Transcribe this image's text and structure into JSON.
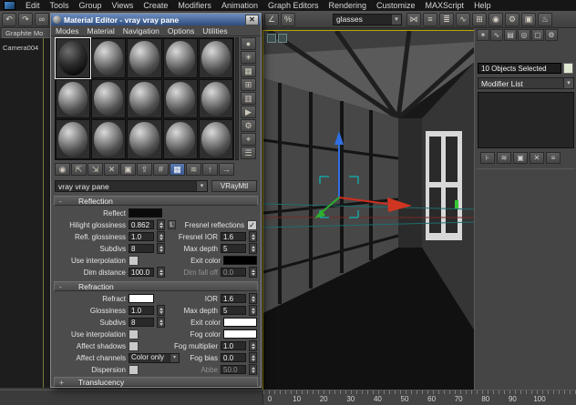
{
  "menubar": {
    "items": [
      "Edit",
      "Tools",
      "Group",
      "Views",
      "Create",
      "Modifiers",
      "Animation",
      "Graph Editors",
      "Rendering",
      "Customize",
      "MAXScript",
      "Help"
    ]
  },
  "icons": {
    "combo_arrow": "▾",
    "close": "✕"
  },
  "main_toolbar": {
    "icons_left": [
      {
        "name": "undo-icon",
        "glyph": "↶"
      },
      {
        "name": "redo-icon",
        "glyph": "↷"
      },
      {
        "name": "select-link-icon",
        "glyph": "∞"
      },
      {
        "name": "unlink-selection-icon",
        "glyph": "⊘"
      },
      {
        "name": "bind-to-space-warp-icon",
        "glyph": "≈"
      },
      {
        "name": "select-object-icon",
        "glyph": "⌖"
      },
      {
        "name": "select-by-name-icon",
        "glyph": "☰"
      },
      {
        "name": "rectangular-selection-region-icon",
        "glyph": "▢"
      },
      {
        "name": "window-crossing-toggle-icon",
        "glyph": "◫"
      },
      {
        "name": "select-and-move-icon",
        "glyph": "✛"
      },
      {
        "name": "select-and-rotate-icon",
        "glyph": "↻"
      },
      {
        "name": "select-and-scale-icon",
        "glyph": "◱"
      },
      {
        "name": "reference-coordinate-system-icon",
        "glyph": "⌂"
      },
      {
        "name": "use-pivot-point-center-icon",
        "glyph": "◉"
      },
      {
        "name": "select-and-manipulate-icon",
        "glyph": "✣"
      },
      {
        "name": "snaps-toggle-icon",
        "glyph": "⌗"
      },
      {
        "name": "angle-snap-toggle-icon",
        "glyph": "∠"
      },
      {
        "name": "percent-snap-toggle-icon",
        "glyph": "%"
      }
    ],
    "selection_set_value": "glasses",
    "icons_right": [
      {
        "name": "mirror-icon",
        "glyph": "⋈"
      },
      {
        "name": "align-icon",
        "glyph": "≡"
      },
      {
        "name": "layer-manager-icon",
        "glyph": "≣"
      },
      {
        "name": "curve-editor-icon",
        "glyph": "∿"
      },
      {
        "name": "schematic-view-icon",
        "glyph": "⊞"
      },
      {
        "name": "material-editor-icon",
        "glyph": "◉"
      },
      {
        "name": "render-setup-icon",
        "glyph": "⚙"
      },
      {
        "name": "rendered-frame-window-icon",
        "glyph": "▣"
      },
      {
        "name": "render-production-icon",
        "glyph": "♨"
      }
    ]
  },
  "ribbon": {
    "tab_label": "Graphite Mo"
  },
  "left_viewport": {
    "camera_label": "Camera004"
  },
  "viewport": {
    "active_border_color": "#b7a500",
    "gizmo_axis_colors": {
      "x": "#d03522",
      "y": "#2fae2f",
      "z": "#2f6fe0"
    }
  },
  "material_editor": {
    "title": "Material Editor - vray vray pane",
    "menu": [
      "Modes",
      "Material",
      "Navigation",
      "Options",
      "Utilities"
    ],
    "swatches": {
      "rows": 3,
      "cols": 5,
      "selected_index": 0
    },
    "vertical_tools": [
      {
        "name": "sample-type-icon",
        "glyph": "●"
      },
      {
        "name": "backlight-icon",
        "glyph": "☀"
      },
      {
        "name": "background-icon",
        "glyph": "▦"
      },
      {
        "name": "sample-uv-tiling-icon",
        "glyph": "⊞"
      },
      {
        "name": "video-color-check-icon",
        "glyph": "▥"
      },
      {
        "name": "make-preview-icon",
        "glyph": "▶"
      },
      {
        "name": "options-icon",
        "glyph": "⚙"
      },
      {
        "name": "select-by-material-icon",
        "glyph": "⌖"
      },
      {
        "name": "material-map-navigator-icon",
        "glyph": "☰"
      }
    ],
    "bottom_tools": [
      {
        "name": "get-material-icon",
        "glyph": "◉"
      },
      {
        "name": "put-material-to-scene-icon",
        "glyph": "⇱"
      },
      {
        "name": "assign-material-to-selection-icon",
        "glyph": "⇲"
      },
      {
        "name": "reset-map-icon",
        "glyph": "✕"
      },
      {
        "name": "make-material-copy-icon",
        "glyph": "▣"
      },
      {
        "name": "put-to-library-icon",
        "glyph": "⇪"
      },
      {
        "name": "material-id-channel-icon",
        "glyph": "#"
      },
      {
        "name": "show-map-in-viewport-icon",
        "glyph": "▦",
        "active": true
      },
      {
        "name": "show-end-result-icon",
        "glyph": "≋"
      },
      {
        "name": "go-to-parent-icon",
        "glyph": "↑"
      },
      {
        "name": "go-forward-to-sibling-icon",
        "glyph": "→"
      }
    ],
    "name_dropdown": "vray vray pane",
    "type_button": "VRayMtl",
    "reflection": {
      "header": "Reflection",
      "reflect": {
        "label": "Reflect",
        "color": "#0a0a0a"
      },
      "hilight_glossiness": {
        "label": "Hilight glossiness",
        "value": "0.862"
      },
      "lock_label": "L",
      "fresnel_reflections": {
        "label": "Fresnel reflections",
        "checked": true
      },
      "refl_glossiness": {
        "label": "Refl. glossiness",
        "value": "1.0"
      },
      "fresnel_ior": {
        "label": "Fresnel IOR",
        "value": "1.6"
      },
      "subdivs": {
        "label": "Subdivs",
        "value": "8"
      },
      "max_depth": {
        "label": "Max depth",
        "value": "5"
      },
      "use_interpolation": {
        "label": "Use interpolation",
        "checked": false
      },
      "exit_color": {
        "label": "Exit color",
        "color": "#000000"
      },
      "dim_distance": {
        "label": "Dim distance",
        "value": "100.0"
      },
      "dim_falloff": {
        "label": "Dim fall off",
        "value": "0.0"
      }
    },
    "refraction": {
      "header": "Refraction",
      "refract": {
        "label": "Refract",
        "color": "#ffffff"
      },
      "ior": {
        "label": "IOR",
        "value": "1.6"
      },
      "glossiness": {
        "label": "Glossiness",
        "value": "1.0"
      },
      "max_depth": {
        "label": "Max depth",
        "value": "5"
      },
      "subdivs": {
        "label": "Subdivs",
        "value": "8"
      },
      "exit_color": {
        "label": "Exit color",
        "color": "#ffffff"
      },
      "use_interpolation": {
        "label": "Use interpolation",
        "checked": false
      },
      "fog_color": {
        "label": "Fog color",
        "color": "#ffffff"
      },
      "affect_shadows": {
        "label": "Affect shadows",
        "checked": false
      },
      "fog_multiplier": {
        "label": "Fog multiplier",
        "value": "1.0"
      },
      "affect_channels": {
        "label": "Affect channels",
        "value": "Color only"
      },
      "fog_bias": {
        "label": "Fog bias",
        "value": "0.0"
      },
      "dispersion": {
        "label": "Dispersion",
        "checked": false
      },
      "abbe": {
        "label": "Abbe",
        "value": "50.0"
      }
    },
    "translucency_header": "Translucency"
  },
  "command_panel": {
    "tabs": [
      {
        "name": "create-tab-icon",
        "glyph": "✶"
      },
      {
        "name": "modify-tab-icon",
        "glyph": "∿"
      },
      {
        "name": "hierarchy-tab-icon",
        "glyph": "▤"
      },
      {
        "name": "motion-tab-icon",
        "glyph": "◎"
      },
      {
        "name": "display-tab-icon",
        "glyph": "▢"
      },
      {
        "name": "utilities-tab-icon",
        "glyph": "⚙"
      }
    ],
    "selection_status": "10 Objects Selected",
    "object_color": "#dfe8d0",
    "modifier_list_label": "Modifier List",
    "stack_buttons": [
      {
        "name": "pin-stack-icon",
        "glyph": "⊦"
      },
      {
        "name": "show-end-result-stack-icon",
        "glyph": "≋"
      },
      {
        "name": "make-unique-icon",
        "glyph": "▣"
      },
      {
        "name": "remove-modifier-icon",
        "glyph": "✕"
      },
      {
        "name": "configure-modifier-sets-icon",
        "glyph": "≡"
      }
    ]
  },
  "timeline": {
    "ticks": [
      "0",
      "10",
      "20",
      "30",
      "40",
      "50",
      "60",
      "70",
      "80",
      "90",
      "100"
    ]
  }
}
